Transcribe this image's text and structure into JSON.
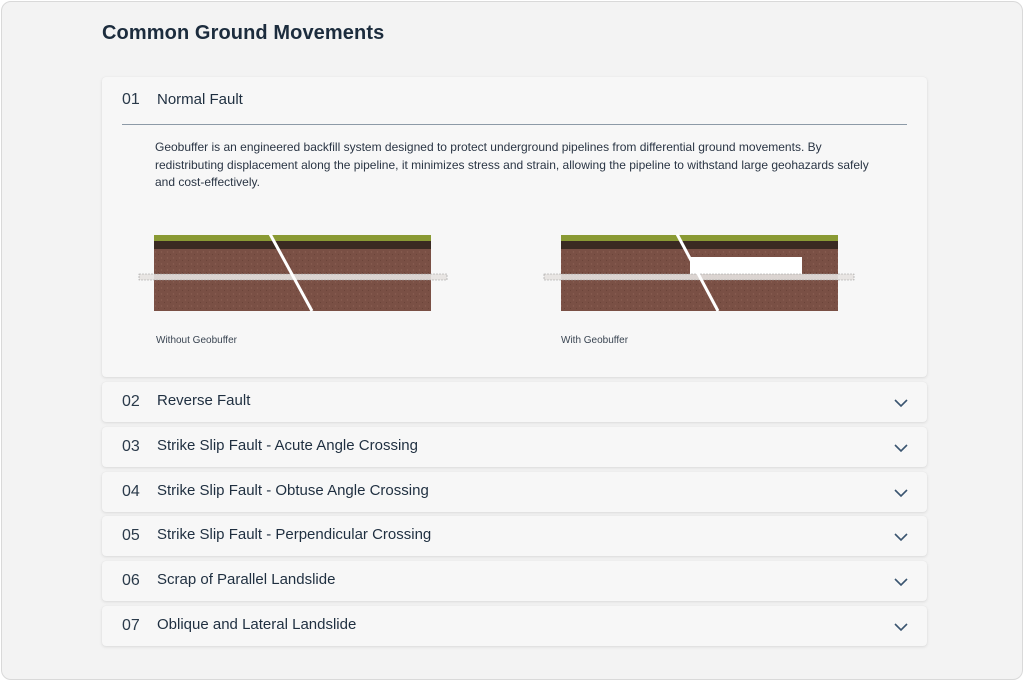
{
  "page": {
    "title": "Common Ground Movements"
  },
  "sections": [
    {
      "number": "01",
      "title": "Normal Fault",
      "expanded": true,
      "description": "Geobuffer is an engineered backfill system designed to protect underground pipelines from differential ground movements. By redistributing displacement along the pipeline, it minimizes stress and strain, allowing the pipeline to withstand large geohazards safely and cost-effectively.",
      "captions": [
        "Without Geobuffer",
        "With Geobuffer"
      ]
    },
    {
      "number": "02",
      "title": "Reverse Fault",
      "expanded": false
    },
    {
      "number": "03",
      "title": "Strike Slip Fault - Acute Angle Crossing",
      "expanded": false
    },
    {
      "number": "04",
      "title": "Strike Slip Fault - Obtuse Angle Crossing",
      "expanded": false
    },
    {
      "number": "05",
      "title": "Strike Slip Fault - Perpendicular Crossing",
      "expanded": false
    },
    {
      "number": "06",
      "title": "Scrap of Parallel Landslide",
      "expanded": false
    },
    {
      "number": "07",
      "title": "Oblique and Lateral Landslide",
      "expanded": false
    }
  ],
  "colors": {
    "grass": "#8a9a34",
    "topsoil": "#3a2a22",
    "soil": "#7a5045",
    "pipe": "#e6e2e0",
    "geobuffer": "#ffffff",
    "fault_line": "#ffffff"
  },
  "icons": {
    "expand": "chevron-down-icon"
  }
}
